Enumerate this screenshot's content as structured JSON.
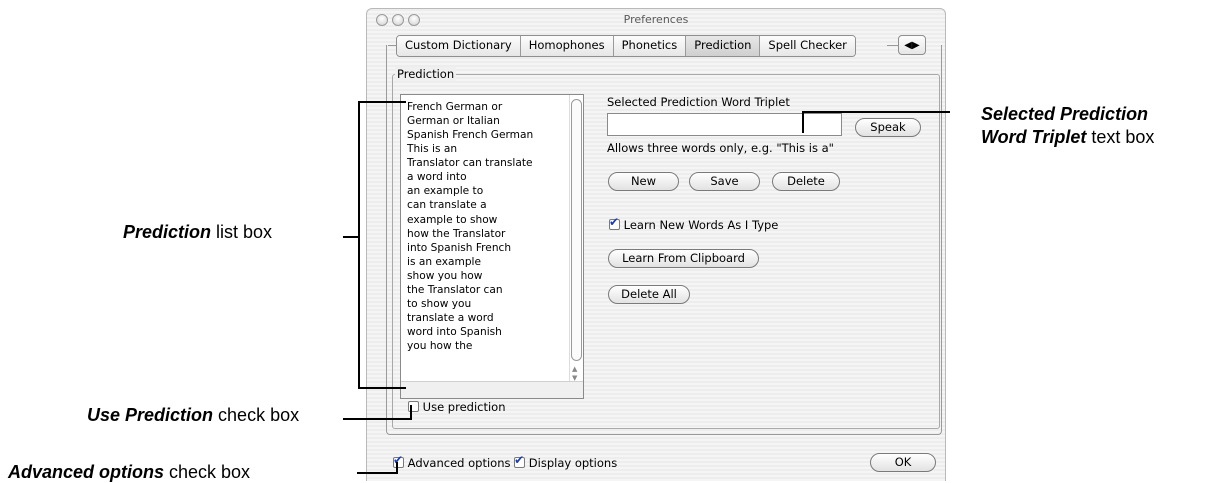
{
  "window": {
    "title": "Preferences"
  },
  "tabs": [
    {
      "label": "Custom Dictionary"
    },
    {
      "label": "Homophones"
    },
    {
      "label": "Phonetics"
    },
    {
      "label": "Prediction",
      "selected": true
    },
    {
      "label": "Spell Checker"
    }
  ],
  "tab_scroll_label": "◀▶",
  "group": {
    "title": "Prediction"
  },
  "prediction_list": [
    "French German or",
    "German or Italian",
    "Spanish French German",
    "This is an",
    "Translator can translate",
    "a word into",
    "an example to",
    "can translate a",
    "example to show",
    "how the Translator",
    "into Spanish French",
    "is an example",
    "show you how",
    "the Translator can",
    "to show you",
    "translate a word",
    "word into Spanish",
    "you how the"
  ],
  "use_prediction": {
    "label": "Use prediction",
    "checked": false
  },
  "triplet": {
    "label": "Selected Prediction Word Triplet",
    "value": "",
    "hint": "Allows three words only, e.g. \"This is a\""
  },
  "buttons": {
    "speak": "Speak",
    "new": "New",
    "save": "Save",
    "delete": "Delete",
    "learn_clipboard": "Learn From Clipboard",
    "delete_all": "Delete All",
    "ok": "OK"
  },
  "learn_new_words": {
    "label": "Learn New Words As I Type",
    "checked": true
  },
  "footer": {
    "advanced": {
      "label": "Advanced options",
      "checked": true
    },
    "display": {
      "label": "Display options",
      "checked": true
    }
  },
  "annotations": {
    "triplet_bold_1": "Selected Prediction",
    "triplet_bold_2": "Word Triplet",
    "triplet_suffix": " text box",
    "list_bold": "Prediction",
    "list_suffix": " list box",
    "use_bold": "Use Prediction",
    "use_suffix": " check box",
    "adv_bold": "Advanced options",
    "adv_suffix": " check box"
  }
}
